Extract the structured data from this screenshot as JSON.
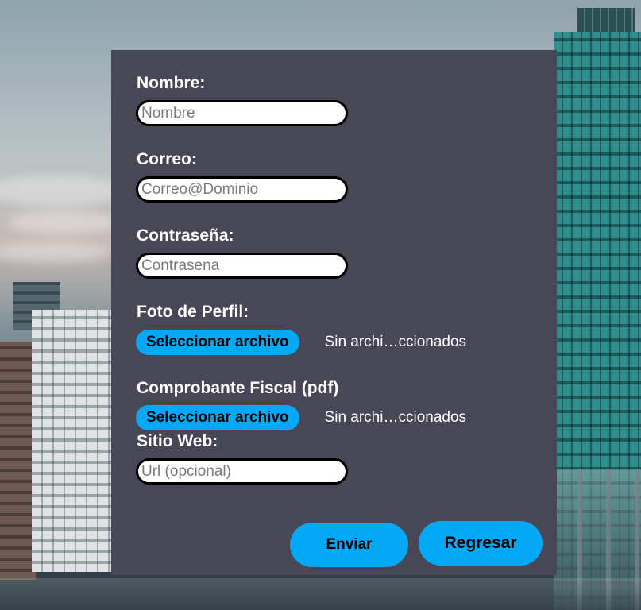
{
  "form": {
    "nombre": {
      "label": "Nombre:",
      "placeholder": "Nombre",
      "value": ""
    },
    "correo": {
      "label": "Correo:",
      "placeholder": "Correo@Dominio",
      "value": ""
    },
    "contrasena": {
      "label": "Contraseña:",
      "placeholder": "Contrasena",
      "value": ""
    },
    "foto": {
      "label": "Foto de Perfil:",
      "button": "Seleccionar archivo",
      "status": "Sin archi…ccionados"
    },
    "comprobante": {
      "label": "Comprobante Fiscal (pdf)",
      "button": "Seleccionar archivo",
      "status": "Sin archi…ccionados"
    },
    "sitio": {
      "label": "Sitio Web:",
      "placeholder": "Url (opcional)",
      "value": ""
    }
  },
  "actions": {
    "enviar": "Enviar",
    "regresar": "Regresar"
  },
  "colors": {
    "panel": "#474756",
    "accent": "#03a9f4"
  }
}
